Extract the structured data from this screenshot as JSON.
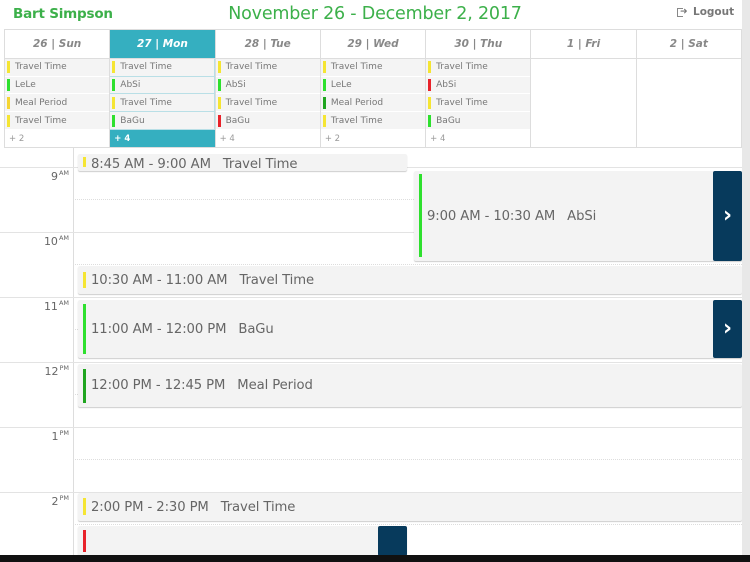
{
  "header": {
    "user_name": "Bart Simpson",
    "week_title": "November 26 - December 2, 2017",
    "logout_label": "Logout",
    "logout_icon": "sign-out-icon"
  },
  "colors": {
    "brand_green": "#3cb04a",
    "active_day": "#35afc0",
    "detail_button": "#073a5c",
    "status_yellow": "#f5e533",
    "status_green": "#2ee02e",
    "status_dark_green": "#1fa51f",
    "status_red": "#e8222a"
  },
  "week": {
    "days": [
      {
        "label": "26 | Sun",
        "active": false,
        "more": "+ 2",
        "events": [
          {
            "title": "Travel Time",
            "status": "#f5e533"
          },
          {
            "title": "LeLe",
            "status": "#2ee02e"
          },
          {
            "title": "Meal Period",
            "status": "#f5d533"
          },
          {
            "title": "Travel Time",
            "status": "#f5e533"
          }
        ]
      },
      {
        "label": "27 | Mon",
        "active": true,
        "more": "+ 4",
        "events": [
          {
            "title": "Travel Time",
            "status": "#f5e533"
          },
          {
            "title": "AbSi",
            "status": "#2ee02e"
          },
          {
            "title": "Travel Time",
            "status": "#f5e533"
          },
          {
            "title": "BaGu",
            "status": "#2ee02e"
          }
        ]
      },
      {
        "label": "28 | Tue",
        "active": false,
        "more": "+ 4",
        "events": [
          {
            "title": "Travel Time",
            "status": "#f5e533"
          },
          {
            "title": "AbSi",
            "status": "#2ee02e"
          },
          {
            "title": "Travel Time",
            "status": "#f5e533"
          },
          {
            "title": "BaGu",
            "status": "#e8222a"
          }
        ]
      },
      {
        "label": "29 | Wed",
        "active": false,
        "more": "+ 2",
        "events": [
          {
            "title": "Travel Time",
            "status": "#f5e533"
          },
          {
            "title": "LeLe",
            "status": "#2ee02e"
          },
          {
            "title": "Meal Period",
            "status": "#1fa51f"
          },
          {
            "title": "Travel Time",
            "status": "#f5e533"
          }
        ]
      },
      {
        "label": "30 | Thu",
        "active": false,
        "more": "+ 4",
        "events": [
          {
            "title": "Travel Time",
            "status": "#f5e533"
          },
          {
            "title": "AbSi",
            "status": "#e8222a"
          },
          {
            "title": "Travel Time",
            "status": "#f5e533"
          },
          {
            "title": "BaGu",
            "status": "#2ee02e"
          }
        ]
      },
      {
        "label": "1 | Fri",
        "active": false,
        "more": "",
        "events": []
      },
      {
        "label": "2 | Sat",
        "active": false,
        "more": "",
        "events": []
      }
    ]
  },
  "timeline": {
    "hours": [
      {
        "hour": "9",
        "period": "AM"
      },
      {
        "hour": "10",
        "period": "AM"
      },
      {
        "hour": "11",
        "period": "AM"
      },
      {
        "hour": "12",
        "period": "PM"
      },
      {
        "hour": "1",
        "period": "PM"
      },
      {
        "hour": "2",
        "period": "PM"
      }
    ],
    "events": [
      {
        "time": "8:45 AM - 9:00 AM",
        "title": "Travel Time",
        "status": "#f5e533",
        "has_detail": false
      },
      {
        "time": "9:00 AM - 10:30 AM",
        "title": "AbSi",
        "status": "#2ee02e",
        "has_detail": true
      },
      {
        "time": "10:30 AM - 11:00 AM",
        "title": "Travel Time",
        "status": "#f5e533",
        "has_detail": false
      },
      {
        "time": "11:00 AM - 12:00 PM",
        "title": "BaGu",
        "status": "#2ee02e",
        "has_detail": true
      },
      {
        "time": "12:00 PM - 12:45 PM",
        "title": "Meal Period",
        "status": "#1fa51f",
        "has_detail": false
      },
      {
        "time": "2:00 PM - 2:30 PM",
        "title": "Travel Time",
        "status": "#f5e533",
        "has_detail": false
      },
      {
        "time": "",
        "title": "",
        "status": "#e8222a",
        "has_detail": true
      }
    ]
  }
}
